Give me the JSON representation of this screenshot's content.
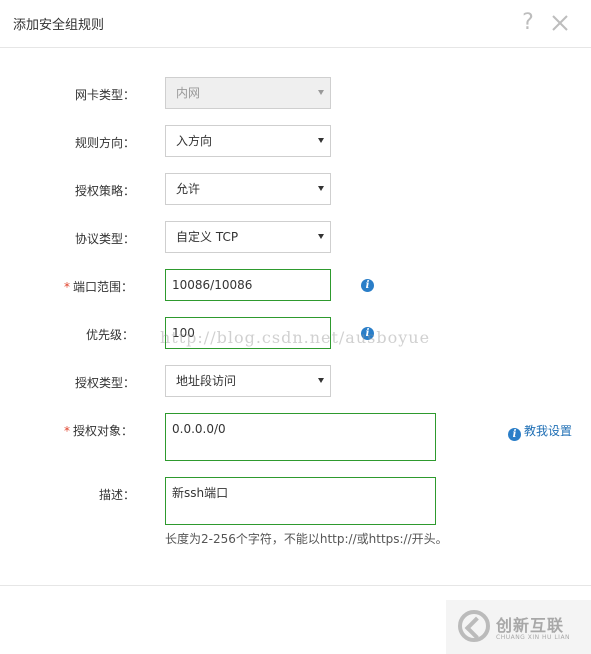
{
  "dialog": {
    "title": "添加安全组规则",
    "help_symbol": "?"
  },
  "form": {
    "nic_type": {
      "label": "网卡类型：",
      "value": "内网",
      "disabled": true
    },
    "direction": {
      "label": "规则方向：",
      "value": "入方向"
    },
    "policy": {
      "label": "授权策略：",
      "value": "允许"
    },
    "protocol": {
      "label": "协议类型：",
      "value": "自定义 TCP"
    },
    "port_range": {
      "required_mark": "*",
      "label": "端口范围：",
      "value": "10086/10086"
    },
    "priority": {
      "label": "优先级：",
      "value": "100"
    },
    "auth_type": {
      "label": "授权类型：",
      "value": "地址段访问"
    },
    "auth_object": {
      "required_mark": "*",
      "label": "授权对象：",
      "value": "0.0.0.0/0",
      "help_link": "教我设置"
    },
    "description": {
      "label": "描述：",
      "value": "新ssh端口",
      "hint": "长度为2-256个字符，不能以http://或https://开头。"
    }
  },
  "watermark": "http://blog.csdn.net/ausboyue",
  "logo": {
    "name_cn": "创新互联",
    "name_en": "CHUANG XIN HU LIAN"
  },
  "colors": {
    "required": "#e0442d",
    "input_border_active": "#2e9a2e",
    "info_icon": "#2a7ec8",
    "link": "#1f6fb5"
  }
}
